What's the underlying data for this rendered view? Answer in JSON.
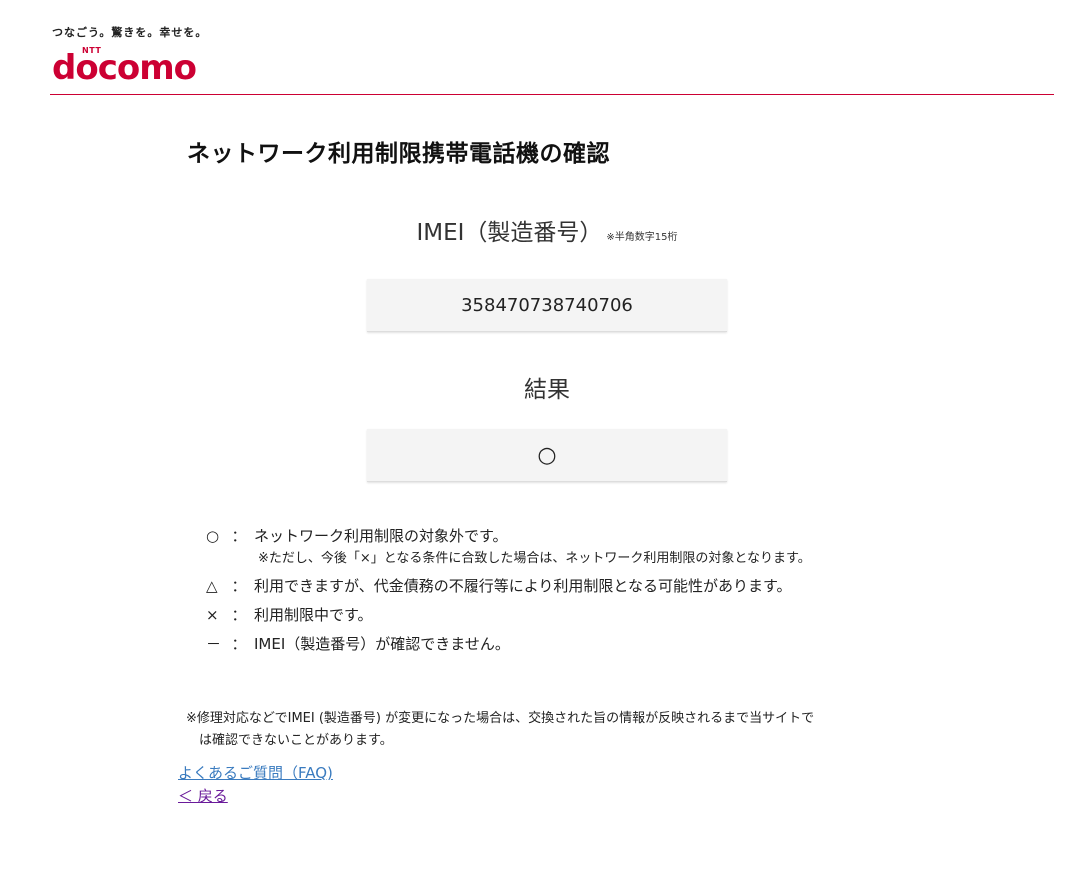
{
  "header": {
    "tagline": "つなごう。驚きを。幸せを。",
    "logo_small": "NTT",
    "logo_text": "docomo",
    "brand_color": "#cc0033"
  },
  "main": {
    "title": "ネットワーク利用制限携帯電話機の確認",
    "imei_label": "IMEI（製造番号）",
    "imei_note": "※半角数字15桁",
    "imei_value": "358470738740706",
    "result_label": "結果",
    "result_value": "○"
  },
  "legend": {
    "items": [
      {
        "symbol": "○",
        "colon": "：",
        "text": "ネットワーク利用制限の対象外です。"
      },
      {
        "symbol": "△",
        "colon": "：",
        "text": "利用できますが、代金債務の不履行等により利用制限となる可能性があります。"
      },
      {
        "symbol": "×",
        "colon": "：",
        "text": "利用制限中です。"
      },
      {
        "symbol": "－",
        "colon": "：",
        "text": "IMEI（製造番号）が確認できません。"
      }
    ],
    "sub_note": "※ただし、今後「×」となる条件に合致した場合は、ネットワーク利用制限の対象となります。"
  },
  "footnote": {
    "line1": "※修理対応などでIMEI (製造番号) が変更になった場合は、交換された旨の情報が反映されるまで当サイトで",
    "line2": "は確認できないことがあります。"
  },
  "links": {
    "faq": "よくあるご質問（FAQ)",
    "back": "＜ 戻る"
  }
}
